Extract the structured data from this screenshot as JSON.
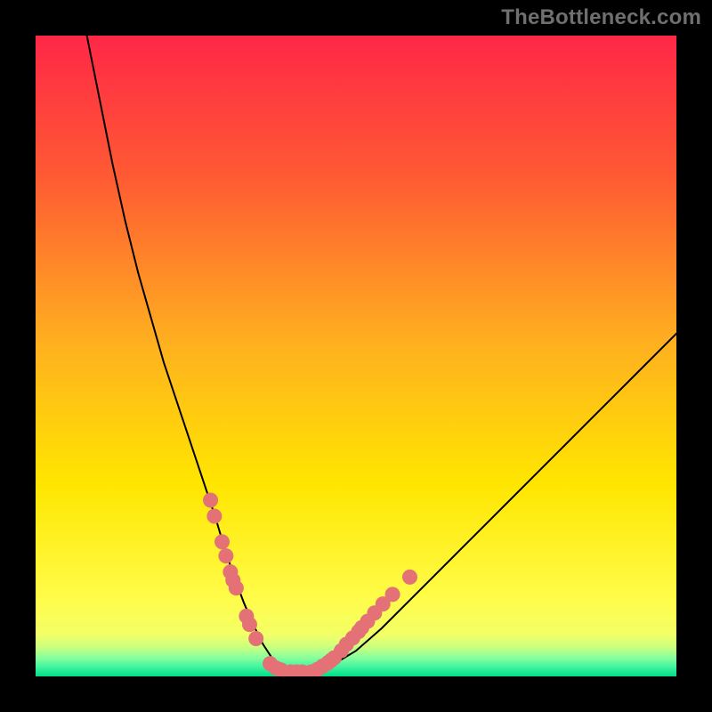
{
  "watermark": "TheBottleneck.com",
  "colors": {
    "curve": "#000000",
    "dots": "#e37176",
    "gradient_top": "#ff2747",
    "gradient_mid": "#ffe600",
    "gradient_green_top": "#e6ff80",
    "gradient_green_bottom": "#00de87",
    "frame": "#000000"
  },
  "chart_data": {
    "type": "line",
    "title": "",
    "xlabel": "",
    "ylabel": "",
    "xlim": [
      0,
      100
    ],
    "ylim": [
      0,
      100
    ],
    "curve": {
      "x": [
        8,
        10,
        12,
        14,
        16,
        18,
        20,
        22,
        24,
        26,
        28,
        29.5,
        31,
        32.5,
        34,
        35.5,
        37,
        39,
        41,
        43,
        46,
        50,
        54,
        58,
        62,
        66,
        70,
        74,
        78,
        82,
        86,
        90,
        94,
        98,
        100
      ],
      "y": [
        100,
        90,
        80,
        71,
        63,
        56,
        49,
        43,
        37,
        31,
        25,
        20,
        15.5,
        11.5,
        8,
        5,
        2.7,
        1.4,
        0.7,
        0.7,
        1.6,
        4,
        7.5,
        11.5,
        15.5,
        19.5,
        23.5,
        27.5,
        31.5,
        35.5,
        39.5,
        43.5,
        47.5,
        51.5,
        53.5
      ]
    },
    "dots": [
      {
        "x": 27.3,
        "y": 27.5
      },
      {
        "x": 27.9,
        "y": 25.0
      },
      {
        "x": 29.1,
        "y": 21.0
      },
      {
        "x": 29.7,
        "y": 18.8
      },
      {
        "x": 30.4,
        "y": 16.3
      },
      {
        "x": 30.8,
        "y": 15.0
      },
      {
        "x": 31.3,
        "y": 13.8
      },
      {
        "x": 32.9,
        "y": 9.4
      },
      {
        "x": 33.4,
        "y": 8.1
      },
      {
        "x": 34.4,
        "y": 5.9
      },
      {
        "x": 36.6,
        "y": 2.0
      },
      {
        "x": 37.5,
        "y": 1.3
      },
      {
        "x": 38.3,
        "y": 1.0
      },
      {
        "x": 39.8,
        "y": 0.7
      },
      {
        "x": 40.7,
        "y": 0.7
      },
      {
        "x": 41.6,
        "y": 0.7
      },
      {
        "x": 43.0,
        "y": 0.7
      },
      {
        "x": 44.0,
        "y": 1.1
      },
      {
        "x": 44.8,
        "y": 1.6
      },
      {
        "x": 45.6,
        "y": 2.1
      },
      {
        "x": 46.1,
        "y": 2.5
      },
      {
        "x": 46.6,
        "y": 2.9
      },
      {
        "x": 47.7,
        "y": 4.0
      },
      {
        "x": 48.5,
        "y": 5.0
      },
      {
        "x": 49.5,
        "y": 6.0
      },
      {
        "x": 50.4,
        "y": 7.0
      },
      {
        "x": 50.9,
        "y": 7.6
      },
      {
        "x": 51.8,
        "y": 8.6
      },
      {
        "x": 52.9,
        "y": 9.9
      },
      {
        "x": 54.2,
        "y": 11.3
      },
      {
        "x": 55.7,
        "y": 12.8
      },
      {
        "x": 58.4,
        "y": 15.5
      }
    ],
    "gradient_bands": [
      {
        "y0": 100,
        "y1": 78,
        "color": "#ff2747"
      },
      {
        "y0": 78,
        "y1": 52,
        "color": "#ff7a2a"
      },
      {
        "y0": 52,
        "y1": 30,
        "color": "#ffc21f"
      },
      {
        "y0": 30,
        "y1": 12,
        "color": "#ffe600"
      },
      {
        "y0": 12,
        "y1": 6.5,
        "color": "#f3ff66"
      },
      {
        "y0": 6.5,
        "y1": 4.5,
        "color": "#c9ff80"
      },
      {
        "y0": 4.5,
        "y1": 3.0,
        "color": "#8bff9c"
      },
      {
        "y0": 3.0,
        "y1": 1.5,
        "color": "#43f4a0"
      },
      {
        "y0": 1.5,
        "y1": 0,
        "color": "#00de87"
      }
    ]
  }
}
